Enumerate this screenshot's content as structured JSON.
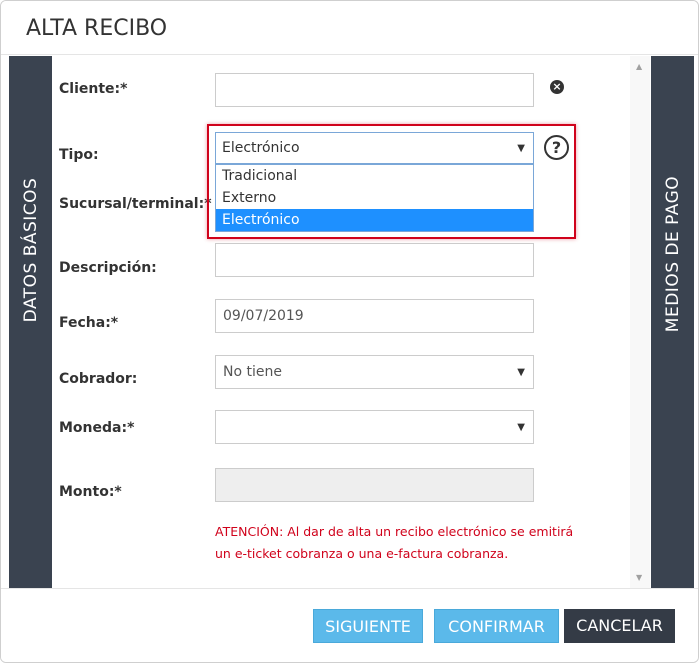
{
  "modal": {
    "title": "ALTA RECIBO"
  },
  "tabs": {
    "left": "DATOS BÁSICOS",
    "right": "MEDIOS DE PAGO"
  },
  "form": {
    "cliente": {
      "label": "Cliente:*",
      "value": ""
    },
    "tipo": {
      "label": "Tipo:",
      "selected": "Electrónico",
      "options": [
        "Tradicional",
        "Externo",
        "Electrónico"
      ]
    },
    "sucursal": {
      "label": "Sucursal/terminal:*"
    },
    "descripcion": {
      "label": "Descripción:",
      "value": ""
    },
    "fecha": {
      "label": "Fecha:*",
      "value": "09/07/2019"
    },
    "cobrador": {
      "label": "Cobrador:",
      "value": "No tiene"
    },
    "moneda": {
      "label": "Moneda:*",
      "value": ""
    },
    "monto": {
      "label": "Monto:*",
      "value": ""
    }
  },
  "warning": {
    "line1": "ATENCIÓN: Al dar de alta un recibo electrónico se emitirá",
    "line2": "un e-ticket cobranza o una e-factura cobranza."
  },
  "buttons": {
    "siguiente": "SIGUIENTE",
    "confirmar": "CONFIRMAR",
    "cancelar": "CANCELAR"
  },
  "icons": {
    "clear": "close-circle-icon",
    "help": "help-icon",
    "caret": "▼",
    "scroll_up": "▲",
    "scroll_down": "▼"
  },
  "colors": {
    "side_tab": "#3a4350",
    "primary_button": "#5bb9ea",
    "dark_button": "#343b46",
    "warning_text": "#d0021b",
    "highlight": "#d0021b",
    "selected_option": "#1e90ff"
  }
}
